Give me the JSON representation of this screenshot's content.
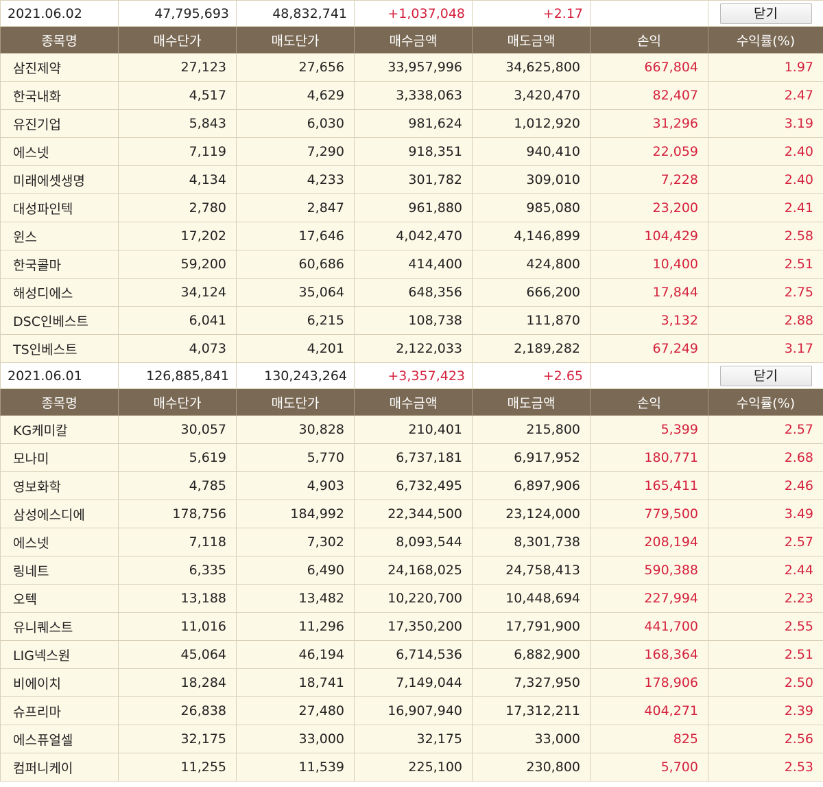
{
  "columns": [
    "종목명",
    "매수단가",
    "매도단가",
    "매수금액",
    "매도금액",
    "손익",
    "수익률(%)"
  ],
  "close_label": "닫기",
  "days": [
    {
      "date": "2021.06.02",
      "total_buy": "47,795,693",
      "total_sell": "48,832,741",
      "profit": "+1,037,048",
      "rate": "+2.17",
      "rows": [
        [
          "삼진제약",
          "27,123",
          "27,656",
          "33,957,996",
          "34,625,800",
          "667,804",
          "1.97"
        ],
        [
          "한국내화",
          "4,517",
          "4,629",
          "3,338,063",
          "3,420,470",
          "82,407",
          "2.47"
        ],
        [
          "유진기업",
          "5,843",
          "6,030",
          "981,624",
          "1,012,920",
          "31,296",
          "3.19"
        ],
        [
          "에스넷",
          "7,119",
          "7,290",
          "918,351",
          "940,410",
          "22,059",
          "2.40"
        ],
        [
          "미래에셋생명",
          "4,134",
          "4,233",
          "301,782",
          "309,010",
          "7,228",
          "2.40"
        ],
        [
          "대성파인텍",
          "2,780",
          "2,847",
          "961,880",
          "985,080",
          "23,200",
          "2.41"
        ],
        [
          "윈스",
          "17,202",
          "17,646",
          "4,042,470",
          "4,146,899",
          "104,429",
          "2.58"
        ],
        [
          "한국콜마",
          "59,200",
          "60,686",
          "414,400",
          "424,800",
          "10,400",
          "2.51"
        ],
        [
          "해성디에스",
          "34,124",
          "35,064",
          "648,356",
          "666,200",
          "17,844",
          "2.75"
        ],
        [
          "DSC인베스트",
          "6,041",
          "6,215",
          "108,738",
          "111,870",
          "3,132",
          "2.88"
        ],
        [
          "TS인베스트",
          "4,073",
          "4,201",
          "2,122,033",
          "2,189,282",
          "67,249",
          "3.17"
        ]
      ]
    },
    {
      "date": "2021.06.01",
      "total_buy": "126,885,841",
      "total_sell": "130,243,264",
      "profit": "+3,357,423",
      "rate": "+2.65",
      "rows": [
        [
          "KG케미칼",
          "30,057",
          "30,828",
          "210,401",
          "215,800",
          "5,399",
          "2.57"
        ],
        [
          "모나미",
          "5,619",
          "5,770",
          "6,737,181",
          "6,917,952",
          "180,771",
          "2.68"
        ],
        [
          "영보화학",
          "4,785",
          "4,903",
          "6,732,495",
          "6,897,906",
          "165,411",
          "2.46"
        ],
        [
          "삼성에스디에",
          "178,756",
          "184,992",
          "22,344,500",
          "23,124,000",
          "779,500",
          "3.49"
        ],
        [
          "에스넷",
          "7,118",
          "7,302",
          "8,093,544",
          "8,301,738",
          "208,194",
          "2.57"
        ],
        [
          "링네트",
          "6,335",
          "6,490",
          "24,168,025",
          "24,758,413",
          "590,388",
          "2.44"
        ],
        [
          "오텍",
          "13,188",
          "13,482",
          "10,220,700",
          "10,448,694",
          "227,994",
          "2.23"
        ],
        [
          "유니퀘스트",
          "11,016",
          "11,296",
          "17,350,200",
          "17,791,900",
          "441,700",
          "2.55"
        ],
        [
          "LIG넥스원",
          "45,064",
          "46,194",
          "6,714,536",
          "6,882,900",
          "168,364",
          "2.51"
        ],
        [
          "비에이치",
          "18,284",
          "18,741",
          "7,149,044",
          "7,327,950",
          "178,906",
          "2.50"
        ],
        [
          "슈프리마",
          "26,838",
          "27,480",
          "16,907,940",
          "17,312,211",
          "404,271",
          "2.39"
        ],
        [
          "에스퓨얼셀",
          "32,175",
          "33,000",
          "32,175",
          "33,000",
          "825",
          "2.56"
        ],
        [
          "컴퍼니케이",
          "11,255",
          "11,539",
          "225,100",
          "230,800",
          "5,700",
          "2.53"
        ]
      ]
    }
  ]
}
